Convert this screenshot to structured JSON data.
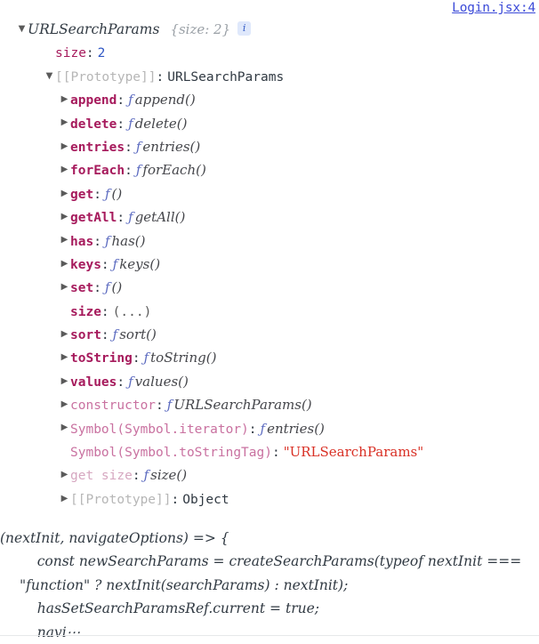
{
  "source_link": {
    "label": "Login.jsx:4"
  },
  "root": {
    "arrow": "▼",
    "name": "URLSearchParams",
    "preview": "{size: 2}",
    "info_badge": "i"
  },
  "own_properties": [
    {
      "arrow": "",
      "key": "size",
      "colon": ":",
      "value": "2",
      "value_type": "number"
    }
  ],
  "prototype_header": {
    "arrow": "▼",
    "key": "[[Prototype]]",
    "colon": ":",
    "value": "URLSearchParams"
  },
  "prototype_members": [
    {
      "arrow": "▶",
      "key": "append",
      "key_style": "own",
      "colon": ":",
      "f": "ƒ",
      "value": "append()",
      "value_type": "function"
    },
    {
      "arrow": "▶",
      "key": "delete",
      "key_style": "own",
      "colon": ":",
      "f": "ƒ",
      "value": "delete()",
      "value_type": "function"
    },
    {
      "arrow": "▶",
      "key": "entries",
      "key_style": "own",
      "colon": ":",
      "f": "ƒ",
      "value": "entries()",
      "value_type": "function"
    },
    {
      "arrow": "▶",
      "key": "forEach",
      "key_style": "own",
      "colon": ":",
      "f": "ƒ",
      "value": "forEach()",
      "value_type": "function"
    },
    {
      "arrow": "▶",
      "key": "get",
      "key_style": "own",
      "colon": ":",
      "f": "ƒ",
      "value": "()",
      "value_type": "function"
    },
    {
      "arrow": "▶",
      "key": "getAll",
      "key_style": "own",
      "colon": ":",
      "f": "ƒ",
      "value": "getAll()",
      "value_type": "function"
    },
    {
      "arrow": "▶",
      "key": "has",
      "key_style": "own",
      "colon": ":",
      "f": "ƒ",
      "value": "has()",
      "value_type": "function"
    },
    {
      "arrow": "▶",
      "key": "keys",
      "key_style": "own",
      "colon": ":",
      "f": "ƒ",
      "value": "keys()",
      "value_type": "function"
    },
    {
      "arrow": "▶",
      "key": "set",
      "key_style": "own",
      "colon": ":",
      "f": "ƒ",
      "value": "()",
      "value_type": "function"
    },
    {
      "arrow": "",
      "key": "size",
      "key_style": "own",
      "colon": ":",
      "f": "",
      "value": "(...)",
      "value_type": "dots"
    },
    {
      "arrow": "▶",
      "key": "sort",
      "key_style": "own",
      "colon": ":",
      "f": "ƒ",
      "value": "sort()",
      "value_type": "function"
    },
    {
      "arrow": "▶",
      "key": "toString",
      "key_style": "own",
      "colon": ":",
      "f": "ƒ",
      "value": "toString()",
      "value_type": "function"
    },
    {
      "arrow": "▶",
      "key": "values",
      "key_style": "own",
      "colon": ":",
      "f": "ƒ",
      "value": "values()",
      "value_type": "function"
    },
    {
      "arrow": "▶",
      "key": "constructor",
      "key_style": "dim",
      "colon": ":",
      "f": "ƒ",
      "value": "URLSearchParams()",
      "value_type": "function"
    },
    {
      "arrow": "▶",
      "key": "Symbol(Symbol.iterator)",
      "key_style": "dim",
      "colon": ":",
      "f": "ƒ",
      "value": "entries()",
      "value_type": "function"
    },
    {
      "arrow": "",
      "key": "Symbol(Symbol.toStringTag)",
      "key_style": "dim",
      "colon": ":",
      "f": "",
      "value": "\"URLSearchParams\"",
      "value_type": "string"
    },
    {
      "arrow": "▶",
      "key": "get size",
      "key_style": "getter",
      "colon": ":",
      "f": "ƒ",
      "value": "size()",
      "value_type": "function"
    },
    {
      "arrow": "▶",
      "key": "[[Prototype]]",
      "key_style": "gray",
      "colon": ":",
      "f": "",
      "value": "Object",
      "value_type": "plain"
    }
  ],
  "function_source": {
    "text": "(nextInit, navigateOptions) => {\n    const newSearchParams = createSearchParams(typeof nextInit === \"function\" ? nextInit(searchParams) : nextInit);\n    hasSetSearchParamsRef.current = true;\n    navi⋯"
  }
}
